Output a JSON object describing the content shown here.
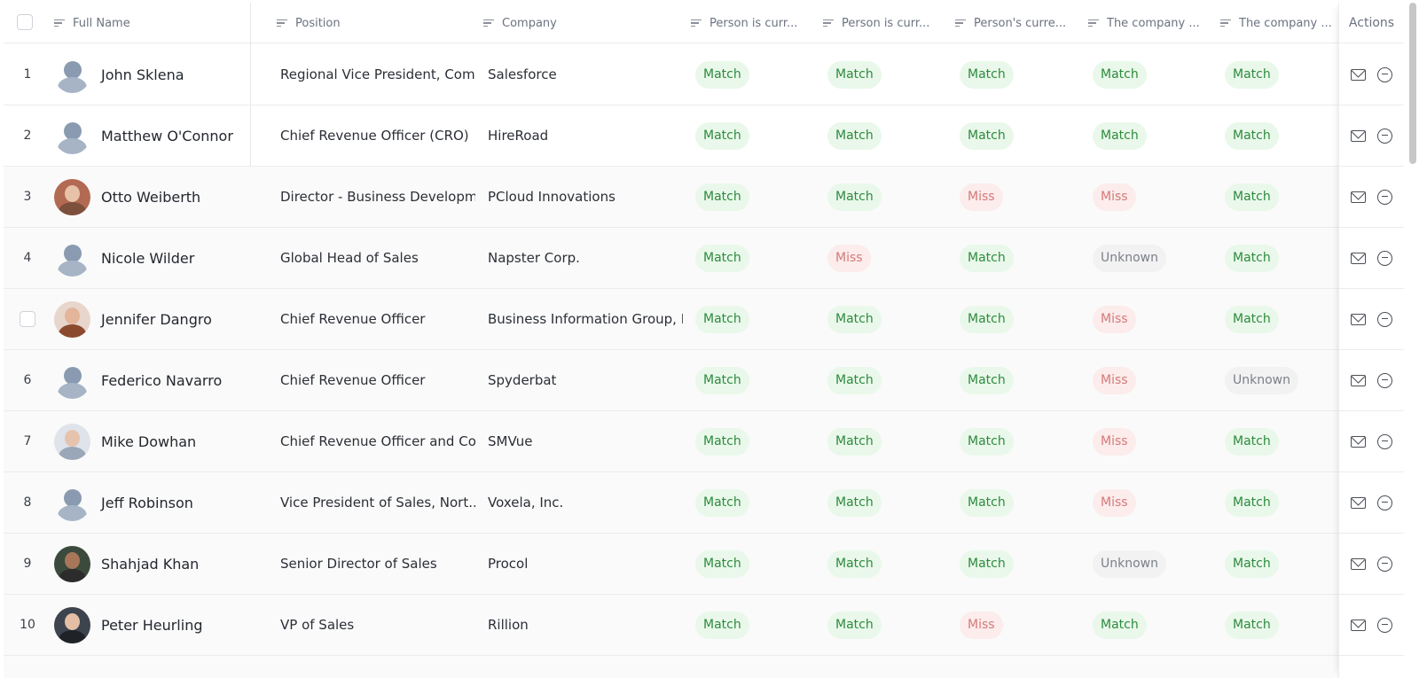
{
  "header": {
    "columns": [
      "Full Name",
      "Position",
      "Company",
      "Person is curr...",
      "Person is curr...",
      "Person's curre...",
      "The company ...",
      "The company ..."
    ],
    "actions_label": "Actions"
  },
  "rows": [
    {
      "num": "1",
      "name": "John Sklena",
      "position": "Regional Vice President, Com...",
      "company": "Salesforce",
      "s1": "Match",
      "s2": "Match",
      "s3": "Match",
      "s4": "Match",
      "s5": "Match"
    },
    {
      "num": "2",
      "name": "Matthew O'Connor",
      "position": "Chief Revenue Officer (CRO)",
      "company": "HireRoad",
      "s1": "Match",
      "s2": "Match",
      "s3": "Match",
      "s4": "Match",
      "s5": "Match"
    },
    {
      "num": "3",
      "name": "Otto Weiberth",
      "position": "Director - Business Developm...",
      "company": "PCloud Innovations",
      "s1": "Match",
      "s2": "Match",
      "s3": "Miss",
      "s4": "Miss",
      "s5": "Match"
    },
    {
      "num": "4",
      "name": "Nicole Wilder",
      "position": "Global Head of Sales",
      "company": "Napster Corp.",
      "s1": "Match",
      "s2": "Miss",
      "s3": "Match",
      "s4": "Unknown",
      "s5": "Match"
    },
    {
      "num": "",
      "name": "Jennifer Dangro",
      "position": "Chief Revenue Officer",
      "company": "Business Information Group, I...",
      "s1": "Match",
      "s2": "Match",
      "s3": "Match",
      "s4": "Miss",
      "s5": "Match"
    },
    {
      "num": "6",
      "name": "Federico Navarro",
      "position": "Chief Revenue Officer",
      "company": "Spyderbat",
      "s1": "Match",
      "s2": "Match",
      "s3": "Match",
      "s4": "Miss",
      "s5": "Unknown"
    },
    {
      "num": "7",
      "name": "Mike Dowhan",
      "position": "Chief Revenue Officer and Co...",
      "company": "SMVue",
      "s1": "Match",
      "s2": "Match",
      "s3": "Match",
      "s4": "Miss",
      "s5": "Match"
    },
    {
      "num": "8",
      "name": "Jeff Robinson",
      "position": "Vice President of Sales, Nort...",
      "company": "Voxela, Inc.",
      "s1": "Match",
      "s2": "Match",
      "s3": "Match",
      "s4": "Miss",
      "s5": "Match"
    },
    {
      "num": "9",
      "name": "Shahjad Khan",
      "position": "Senior Director of Sales",
      "company": "Procol",
      "s1": "Match",
      "s2": "Match",
      "s3": "Match",
      "s4": "Unknown",
      "s5": "Match"
    },
    {
      "num": "10",
      "name": "Peter Heurling",
      "position": "VP of Sales",
      "company": "Rillion",
      "s1": "Match",
      "s2": "Match",
      "s3": "Miss",
      "s4": "Match",
      "s5": "Match"
    }
  ],
  "colors": {
    "match_bg": "#e9f8ea",
    "match_text": "#2e8a3e",
    "miss_bg": "#fcecec",
    "miss_text": "#d47a7a",
    "unknown_bg": "#f2f2f3",
    "unknown_text": "#7a7f87"
  },
  "icons": {
    "row_actions": [
      "mail-icon",
      "minus-circle-icon"
    ],
    "column_sort": "sort-lines-icon",
    "avatar_placeholder": "person-silhouette-icon"
  }
}
